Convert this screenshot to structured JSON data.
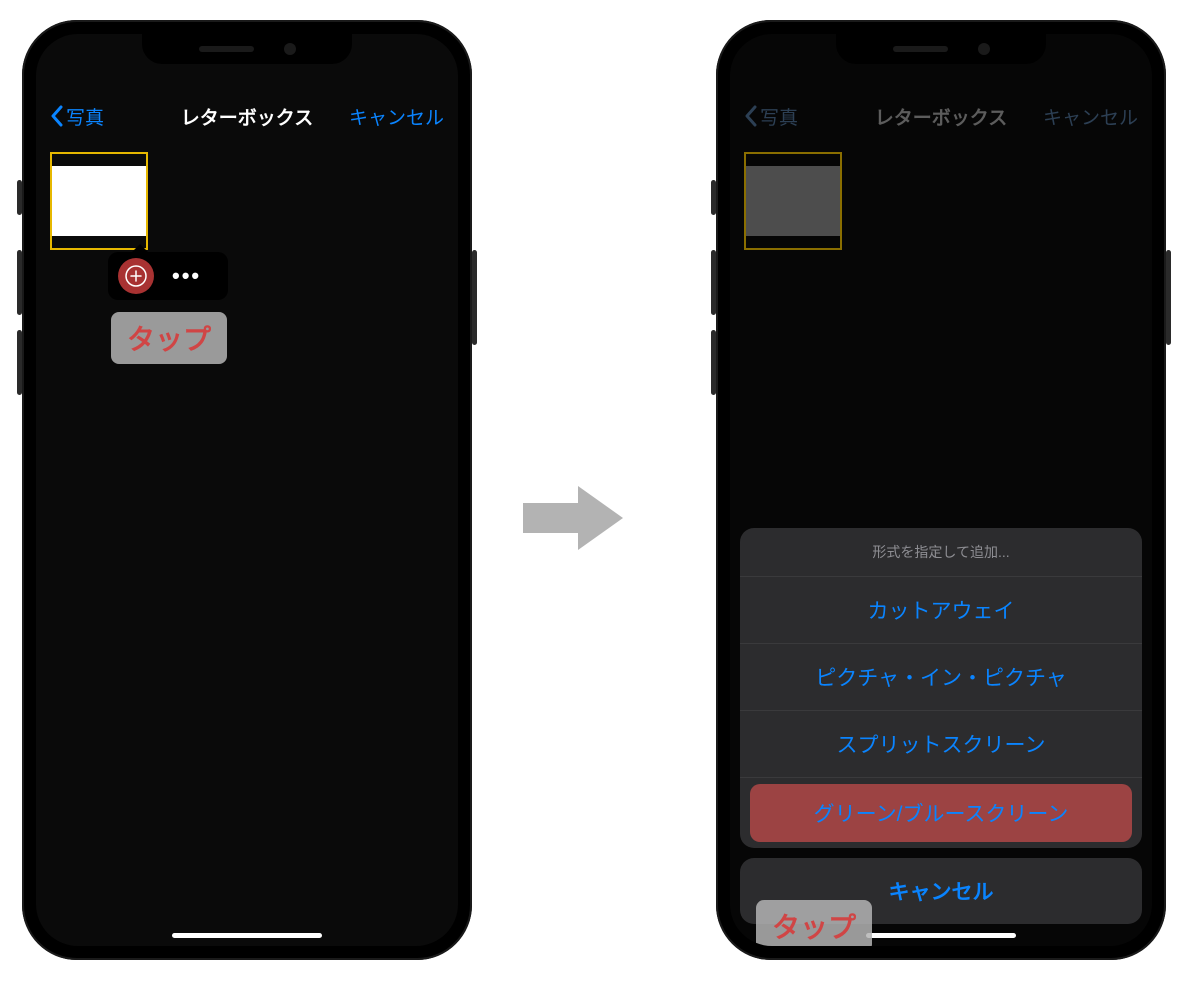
{
  "nav": {
    "back": "写真",
    "title": "レターボックス",
    "cancel": "キャンセル"
  },
  "tap_label": "タップ",
  "sheet": {
    "header": "形式を指定して追加...",
    "options": [
      "カットアウェイ",
      "ピクチャ・イン・ピクチャ",
      "スプリットスクリーン",
      "グリーン/ブルースクリーン"
    ],
    "cancel": "キャンセル"
  }
}
